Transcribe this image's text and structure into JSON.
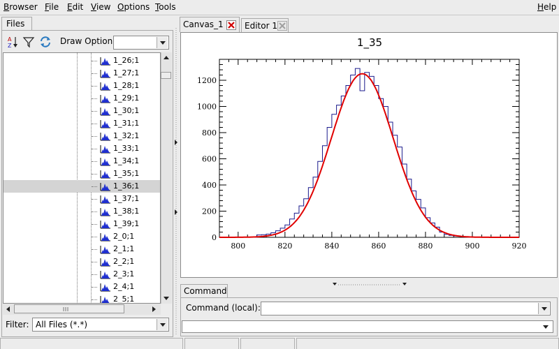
{
  "menubar": {
    "items": [
      {
        "label": "Browser",
        "accel": "B",
        "rest": "rowser"
      },
      {
        "label": "File",
        "accel": "F",
        "rest": "ile"
      },
      {
        "label": "Edit",
        "accel": "E",
        "rest": "dit"
      },
      {
        "label": "View",
        "accel": "V",
        "rest": "iew"
      },
      {
        "label": "Options",
        "accel": "O",
        "rest": "ptions"
      },
      {
        "label": "Tools",
        "accel": "T",
        "rest": "ools"
      }
    ],
    "help": {
      "accel": "H",
      "rest": "elp"
    }
  },
  "left_panel": {
    "tab_label": "Files",
    "toolbar_icons": [
      "sort-icon",
      "filter-icon",
      "refresh-icon"
    ],
    "draw_option_label": "Draw Option:",
    "draw_option_value": "",
    "tree_items": [
      {
        "label": "1_26;1"
      },
      {
        "label": "1_27;1"
      },
      {
        "label": "1_28;1"
      },
      {
        "label": "1_29;1"
      },
      {
        "label": "1_30;1"
      },
      {
        "label": "1_31;1"
      },
      {
        "label": "1_32;1"
      },
      {
        "label": "1_33;1"
      },
      {
        "label": "1_34;1"
      },
      {
        "label": "1_35;1"
      },
      {
        "label": "1_36;1",
        "selected": true
      },
      {
        "label": "1_37;1"
      },
      {
        "label": "1_38;1"
      },
      {
        "label": "1_39;1"
      },
      {
        "label": "2_0;1"
      },
      {
        "label": "2_1;1"
      },
      {
        "label": "2_2;1"
      },
      {
        "label": "2_3;1"
      },
      {
        "label": "2_4;1"
      },
      {
        "label": "2_5;1"
      }
    ],
    "filter_label": "Filter:",
    "filter_value": "All Files (*.*)"
  },
  "tabs": [
    {
      "label": "Canvas_1",
      "active": true
    },
    {
      "label": "Editor 1",
      "active": false
    }
  ],
  "command": {
    "tab_label": "Command",
    "input_label": "Command (local):",
    "input_value": "",
    "history_value": ""
  },
  "colors": {
    "hist_line": "#1a1a8c",
    "fit_line": "#e00000",
    "tree_icon": "#1f2fd0"
  },
  "chart_data": {
    "type": "histogram",
    "title": "1_35",
    "xlim": [
      792,
      920
    ],
    "ylim": [
      0,
      1360
    ],
    "x_ticks": [
      800,
      820,
      840,
      860,
      880,
      900,
      920
    ],
    "y_ticks": [
      0,
      200,
      400,
      600,
      800,
      1000,
      1200
    ],
    "bin_width": 2,
    "bin_start": 792,
    "bin_counts": [
      0,
      0,
      0,
      0,
      0,
      0,
      0,
      0,
      18,
      20,
      25,
      35,
      50,
      70,
      95,
      140,
      185,
      240,
      295,
      380,
      460,
      580,
      700,
      840,
      940,
      1010,
      1080,
      1160,
      1240,
      1290,
      1120,
      1260,
      1230,
      1160,
      1060,
      1000,
      880,
      780,
      690,
      560,
      445,
      355,
      290,
      225,
      150,
      110,
      78,
      40,
      22,
      15,
      10,
      8,
      3,
      0,
      0,
      0,
      0,
      0,
      0,
      0,
      0,
      0,
      0,
      0
    ],
    "fit": {
      "type": "gaussian",
      "constant": 1250,
      "mean": 853,
      "sigma": 13.2
    }
  }
}
